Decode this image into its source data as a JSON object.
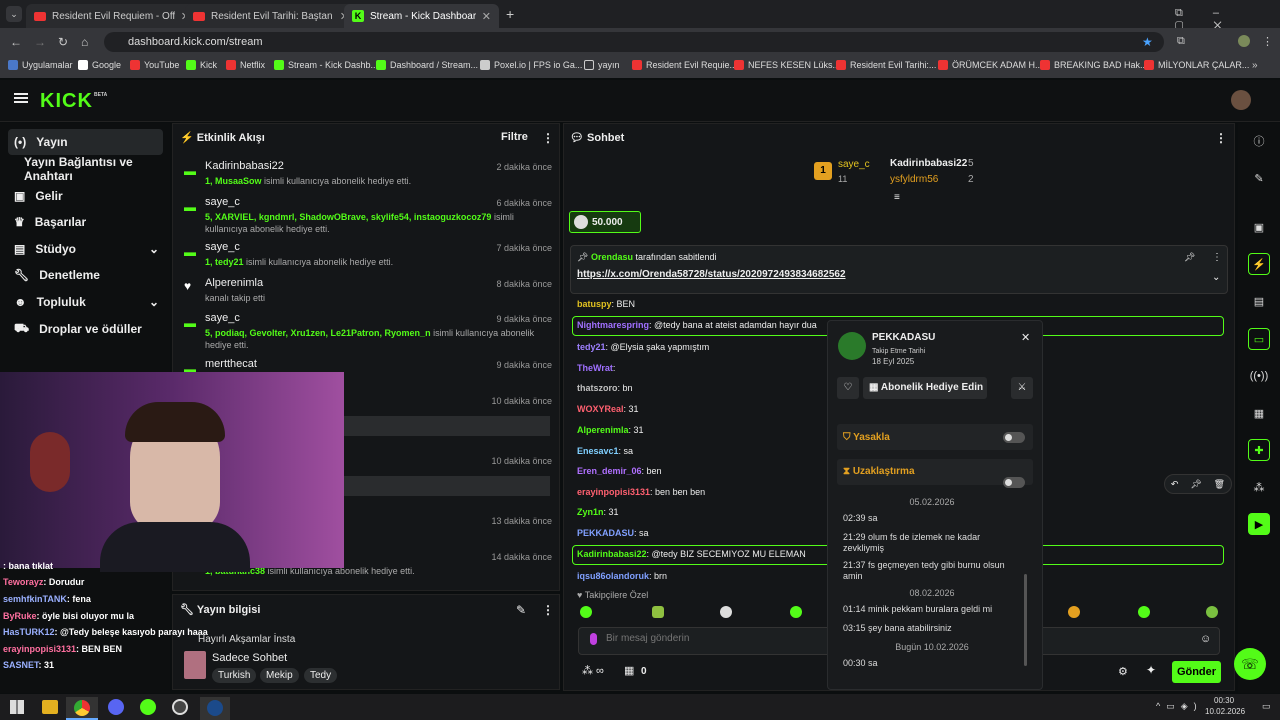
{
  "browser": {
    "tabs": [
      {
        "title": "Resident Evil Requiem - Official"
      },
      {
        "title": "Resident Evil Tarihi: Baştan Sona"
      },
      {
        "title": "Stream - Kick Dashboard"
      }
    ],
    "url": "dashboard.kick.com/stream",
    "bookmarks": [
      "Uygulamalar",
      "Google",
      "YouTube",
      "Kick",
      "Netflix",
      "Stream - Kick Dashb...",
      "Dashboard / Stream...",
      "Poxel.io | FPS io Ga...",
      "yayın",
      "Resident Evil Requie...",
      "NEFES KESEN Lüks...",
      "Resident Evil Tarihi:...",
      "ÖRÜMCEK ADAM H...",
      "BREAKING BAD Hak...",
      "MİLYONLAR ÇALAR..."
    ]
  },
  "logo": "KICK",
  "logo_badge": "BETA",
  "nav": {
    "items": [
      "Yayın",
      "Yayın Bağlantısı ve Anahtarı",
      "Gelir",
      "Başarılar",
      "Stüdyo",
      "Denetleme",
      "Topluluk",
      "Droplar ve ödüller"
    ]
  },
  "activity": {
    "title": "Etkinlik Akışı",
    "filter": "Filtre",
    "events": [
      {
        "user": "Kadirinbabasi22",
        "time": "2 dakika önce",
        "hl": "1, MusaaSow",
        "text": " isimli kullanıcıya abonelik hediye etti."
      },
      {
        "user": "saye_c",
        "time": "6 dakika önce",
        "hl": "5, XARVIEL, kgndmrl, ShadowOBrave, skylife54, instaoguzkocoz79",
        "text": " isimli kullanıcıya abonelik hediye etti."
      },
      {
        "user": "saye_c",
        "time": "7 dakika önce",
        "hl": "1, tedy21",
        "text": " isimli kullanıcıya abonelik hediye etti."
      },
      {
        "user": "Alperenimla",
        "time": "8 dakika önce",
        "hl": "",
        "text": "kanalı takip etti"
      },
      {
        "user": "saye_c",
        "time": "9 dakika önce",
        "hl": "5, podiaq, Gevolter, Xru1zen, Le21Patron, Ryomen_n",
        "text": " isimli kullanıcıya abonelik hediye etti."
      },
      {
        "user": "mertthecat",
        "time": "9 dakika önce",
        "hl": "",
        "text": "e etti."
      },
      {
        "user": "",
        "time": "10 dakika önce",
        "hl": "",
        "text": "am abonelik süresi - 5 ay!"
      },
      {
        "user": "",
        "time": "10 dakika önce",
        "hl": "",
        "text": "am abonelik süresi - 5 ay!"
      },
      {
        "user": "",
        "time": "13 dakika önce",
        "hl": "",
        "text": "e etti."
      },
      {
        "user": "",
        "time": "14 dakika önce",
        "hl": "1, batuhanc38",
        "text": " isimli kullanıcıya abonelik hediye etti."
      }
    ]
  },
  "stream_info": {
    "title": "Yayın bilgisi",
    "stream_title": "Hayırlı Akşamlar İnsta",
    "category": "Sadece Sohbet",
    "tags": [
      "Turkish",
      "Mekip",
      "Tedy"
    ]
  },
  "chat": {
    "title": "Sohbet",
    "leaders": [
      {
        "rank": "1",
        "name": "saye_c",
        "count": "11"
      },
      {
        "name": "Kadirinbabasi22",
        "count": "5"
      },
      {
        "name": "ysfyldrm56",
        "count": "2"
      }
    ],
    "goal": "50.000",
    "pinned_by": "Orendasu",
    "pinned_label": " tarafından sabitlendi",
    "pinned_link": "https://x.com/Orenda58728/status/2020972493834682562",
    "messages": [
      {
        "u": "batuspy",
        "c": "#e3c320",
        "m": ": BEN"
      },
      {
        "u": "Nightmarespring",
        "c": "#a070ff",
        "m": ": @tedy bana at ateist adamdan hayır dua"
      },
      {
        "u": "tedy21",
        "c": "#9e80ff",
        "m": ": @Elysia şaka yapmıştım"
      },
      {
        "u": "TheWrat",
        "c": "#a070ff",
        "m": ":"
      },
      {
        "u": "thatszoro",
        "c": "#c0c0c0",
        "m": ": bn"
      },
      {
        "u": "WOXYReal",
        "c": "#ff6070",
        "m": ": 31"
      },
      {
        "u": "Alperenimla",
        "c": "#53fc18",
        "m": ": 31"
      },
      {
        "u": "Enesavc1",
        "c": "#80d0ff",
        "m": ": sa"
      },
      {
        "u": "Eren_demir_06",
        "c": "#b070ff",
        "m": ": ben"
      },
      {
        "u": "erayinpopisi3131",
        "c": "#ff6070",
        "m": ": ben ben ben"
      },
      {
        "u": "Zyn1n",
        "c": "#53fc18",
        "m": ": 31"
      },
      {
        "u": "PEKKADASU",
        "c": "#80a0ff",
        "m": ": sa"
      },
      {
        "u": "Kadirinbabasi22",
        "c": "#53fc18",
        "m": ": @tedy BIZ SECEMIYOZ MU ELEMAN"
      },
      {
        "u": "iqsu86olandoruk",
        "c": "#80a0ff",
        "m": ": brn"
      }
    ],
    "followers_only": "Takipçilere Özel",
    "placeholder": "Bir mesaj gönderin",
    "send": "Gönder",
    "count": "0"
  },
  "user_card": {
    "name": "PEKKADASU",
    "follow_label": "Takip Etme Tarihi",
    "follow_date": "18 Eyl 2025",
    "gift_btn": "Abonelik Hediye Edin",
    "ban": "Yasakla",
    "timeout": "Uzaklaştırma",
    "history": [
      {
        "d": "05.02.2026"
      },
      {
        "t": "02:39",
        "m": "sa"
      },
      {
        "t": "21:29",
        "m": "olum fs de izlemek ne kadar zevkliymiş"
      },
      {
        "t": "21:37",
        "m": "fs geçmeyen tedy gibi burnu olsun amin"
      },
      {
        "d": "08.02.2026"
      },
      {
        "t": "01:14",
        "m": "minik pekkam buralara geldi mi"
      },
      {
        "t": "03:15",
        "m": "şey bana atabilirsiniz"
      },
      {
        "d": "Bugün 10.02.2026"
      },
      {
        "t": "00:30",
        "m": "sa"
      }
    ]
  },
  "overlay_chat": [
    {
      "u": "",
      "m": ": bana tıklat"
    },
    {
      "u": "Teworayz",
      "m": ": Dorudur"
    },
    {
      "u": "semhfkinTANK",
      "m": ": fena"
    },
    {
      "u": "ByRuke",
      "m": ": öyle bisi oluyor mu la"
    },
    {
      "u": "HasTURK12",
      "m": ": @Tedy beleşe kasıyob parayı haaa"
    },
    {
      "u": "erayinpopisi3131",
      "m": ": BEN BEN"
    },
    {
      "u": "SASNET",
      "m": ": 31"
    }
  ],
  "taskbar": {
    "time": "00:30",
    "date": "10.02.2026"
  }
}
